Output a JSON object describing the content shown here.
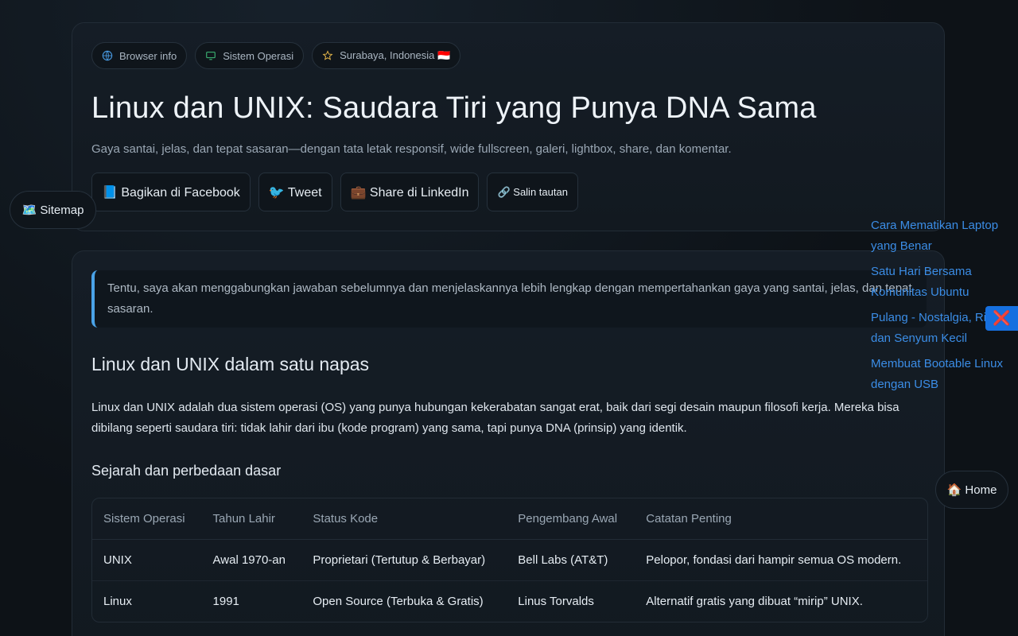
{
  "chips": [
    {
      "label": "Browser info",
      "icon": "globe-icon"
    },
    {
      "label": "Sistem Operasi",
      "icon": "monitor-icon"
    },
    {
      "label": "Surabaya, Indonesia 🇮🇩",
      "icon": "star-icon"
    }
  ],
  "hero": {
    "title": "Linux dan UNIX: Saudara Tiri yang Punya DNA Sama",
    "subtitle": "Gaya santai, jelas, dan tepat sasaran—dengan tata letak responsif, wide fullscreen, galeri, lightbox, share, dan komentar."
  },
  "share": {
    "facebook": "📘 Bagikan di Facebook",
    "tweet": "🐦 Tweet",
    "linkedin": "💼 Share di LinkedIn",
    "copy": "🔗 Salin tautan"
  },
  "content": {
    "quote": "Tentu, saya akan menggabungkan jawaban sebelumnya dan menjelaskannya lebih lengkap dengan mempertahankan gaya yang santai, jelas, dan tepat sasaran.",
    "h2": "Linux dan UNIX dalam satu napas",
    "para": "Linux dan UNIX adalah dua sistem operasi (OS) yang punya hubungan kekerabatan sangat erat, baik dari segi desain maupun filosofi kerja. Mereka bisa dibilang seperti saudara tiri: tidak lahir dari ibu (kode program) yang sama, tapi punya DNA (prinsip) yang identik.",
    "h3": "Sejarah dan perbedaan dasar"
  },
  "table": {
    "headers": [
      "Sistem Operasi",
      "Tahun Lahir",
      "Status Kode",
      "Pengembang Awal",
      "Catatan Penting"
    ],
    "rows": [
      [
        "UNIX",
        "Awal 1970-an",
        "Proprietari (Tertutup & Berbayar)",
        "Bell Labs (AT&T)",
        "Pelopor, fondasi dari hampir semua OS modern."
      ],
      [
        "Linux",
        "1991",
        "Open Source (Terbuka & Gratis)",
        "Linus Torvalds",
        "Alternatif gratis yang dibuat “mirip” UNIX."
      ]
    ]
  },
  "floating": {
    "sitemap": "🗺️ Sitemap",
    "home": "🏠 Home",
    "close": "❌"
  },
  "side_links": [
    "Cara Mematikan Laptop yang Benar",
    "Satu Hari Bersama Komunitas Ubuntu",
    "Pulang - Nostalgia, Rindu, dan Senyum Kecil",
    "Membuat Bootable Linux dengan USB"
  ],
  "colors": {
    "accent": "#3b8de6",
    "quote_border": "#4aa3e8",
    "close_bg": "#1670e0"
  }
}
